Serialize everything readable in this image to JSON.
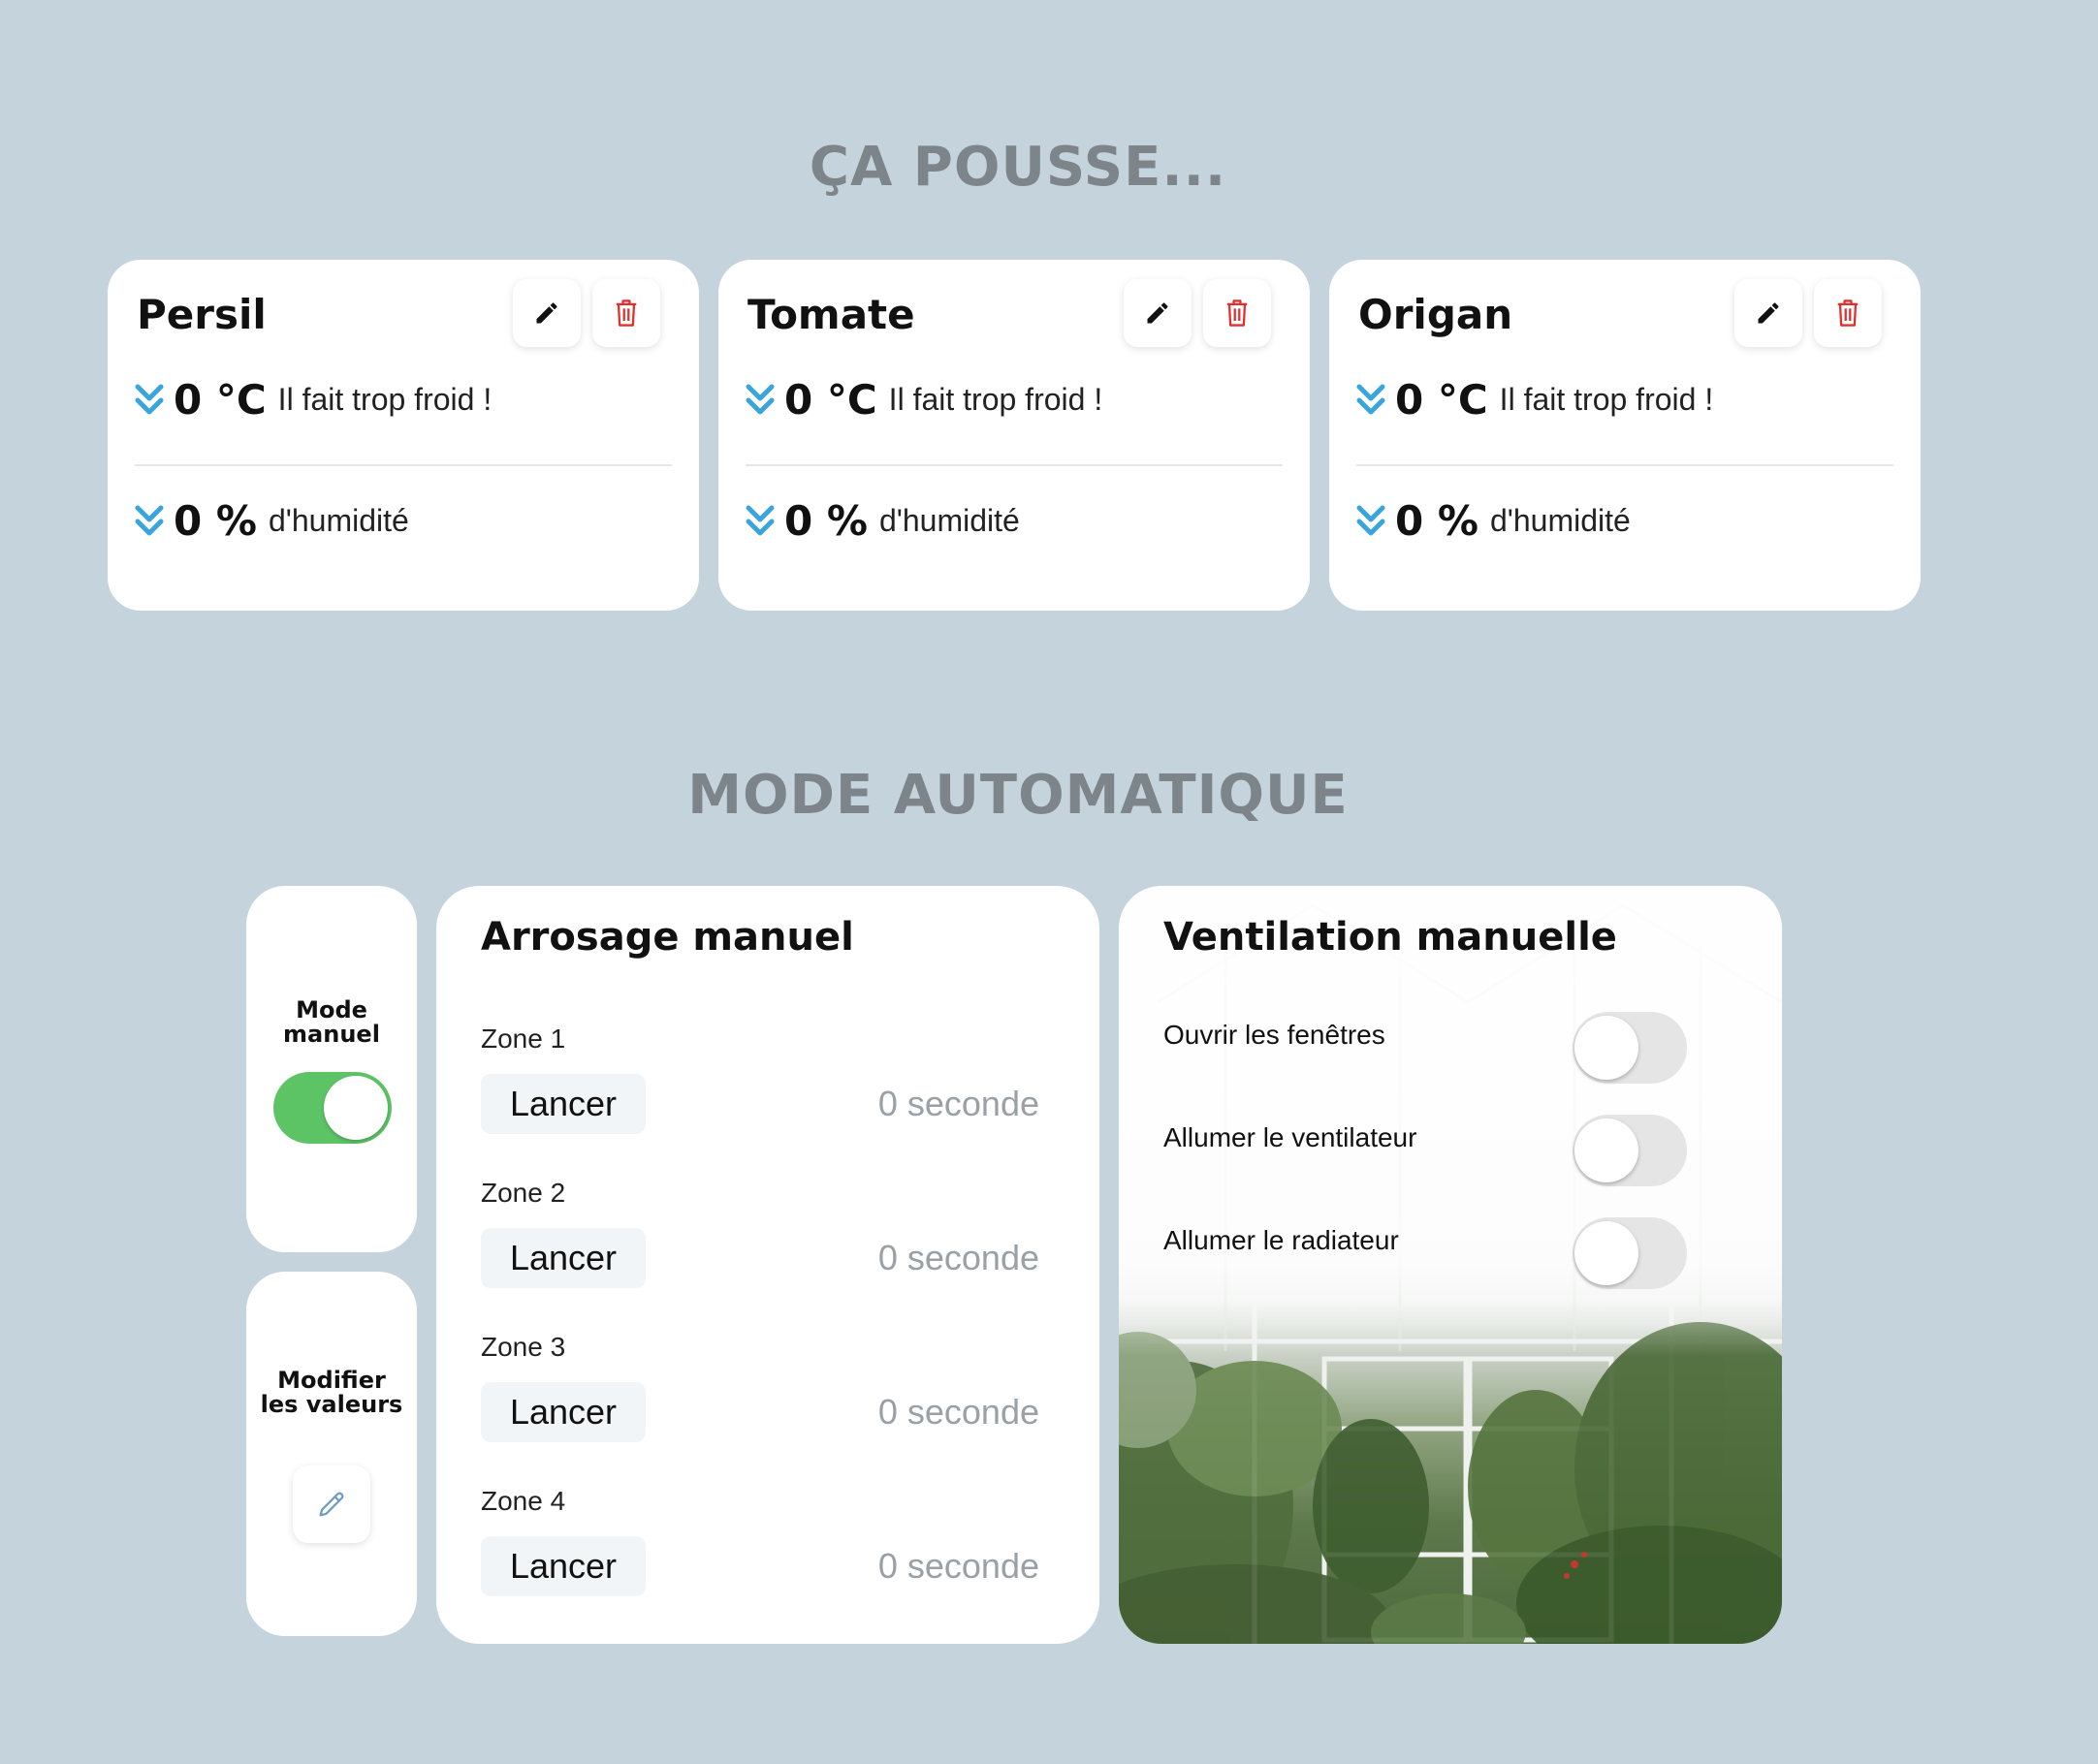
{
  "sections": {
    "growing_title": "ÇA POUSSE...",
    "auto_title": "MODE AUTOMATIQUE"
  },
  "plants": [
    {
      "name": "Persil",
      "temp_value": "0 °C",
      "temp_text": "Il fait trop froid !",
      "hum_value": "0 %",
      "hum_text": "d'humidité"
    },
    {
      "name": "Tomate",
      "temp_value": "0 °C",
      "temp_text": "Il fait trop froid !",
      "hum_value": "0 %",
      "hum_text": "d'humidité"
    },
    {
      "name": "Origan",
      "temp_value": "0 °C",
      "temp_text": "Il fait trop froid !",
      "hum_value": "0 %",
      "hum_text": "d'humidité"
    }
  ],
  "mode_card": {
    "label_line1": "Mode",
    "label_line2": "manuel",
    "toggle_on": true
  },
  "modify_card": {
    "label_line1": "Modifier",
    "label_line2": "les valeurs"
  },
  "watering": {
    "title": "Arrosage manuel",
    "zones": [
      {
        "label": "Zone 1",
        "button": "Lancer",
        "time": "0 seconde"
      },
      {
        "label": "Zone 2",
        "button": "Lancer",
        "time": "0 seconde"
      },
      {
        "label": "Zone 3",
        "button": "Lancer",
        "time": "0 seconde"
      },
      {
        "label": "Zone 4",
        "button": "Lancer",
        "time": "0 seconde"
      }
    ]
  },
  "ventilation": {
    "title": "Ventilation manuelle",
    "options": [
      {
        "label": "Ouvrir les fenêtres",
        "on": false
      },
      {
        "label": "Allumer le ventilateur",
        "on": false
      },
      {
        "label": "Allumer le radiateur",
        "on": false
      }
    ]
  },
  "colors": {
    "background": "#c5d3dc",
    "toggle_on": "#5dc466",
    "chevron": "#3aa5dc",
    "delete": "#e0302e"
  }
}
